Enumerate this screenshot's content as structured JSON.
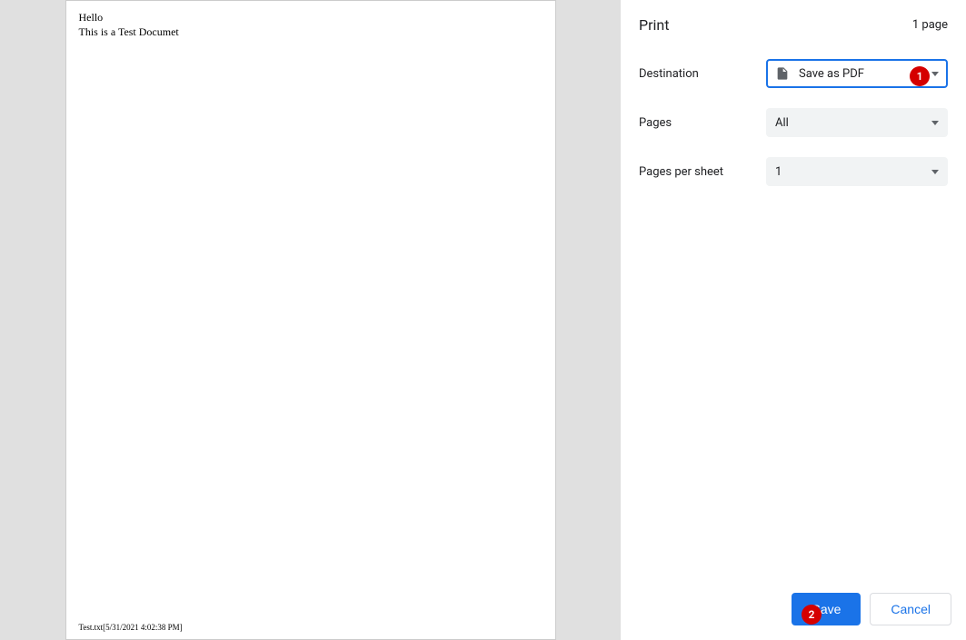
{
  "preview": {
    "line1": "Hello",
    "line2": "This is a Test Documet",
    "footer": "Test.txt[5/31/2021 4:02:38 PM]"
  },
  "sidebar": {
    "title": "Print",
    "page_count": "1 page",
    "options": {
      "destination": {
        "label": "Destination",
        "value": "Save as PDF"
      },
      "pages": {
        "label": "Pages",
        "value": "All"
      },
      "per_sheet": {
        "label": "Pages per sheet",
        "value": "1"
      }
    },
    "buttons": {
      "save": "Save",
      "cancel": "Cancel"
    }
  },
  "callouts": {
    "one": "1",
    "two": "2"
  }
}
